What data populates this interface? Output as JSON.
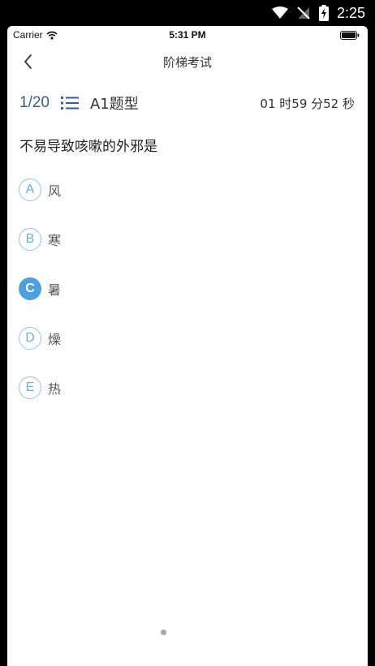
{
  "system_status": {
    "time": "2:25"
  },
  "ios_status": {
    "carrier": "Carrier",
    "time": "5:31 PM"
  },
  "nav": {
    "title": "阶梯考试"
  },
  "exam": {
    "progress": "1/20",
    "type": "A1题型",
    "timer": "01 时59 分52 秒"
  },
  "question": {
    "text": "不易导致咳嗽的外邪是",
    "options": [
      {
        "letter": "A",
        "text": "风"
      },
      {
        "letter": "B",
        "text": "寒"
      },
      {
        "letter": "C",
        "text": "暑",
        "selected": true
      },
      {
        "letter": "D",
        "text": "燥"
      },
      {
        "letter": "E",
        "text": "热"
      }
    ]
  },
  "colors": {
    "accent": "#4c9fe0",
    "progress": "#2f5ea8",
    "badge_outline": "#8fc3e9"
  }
}
